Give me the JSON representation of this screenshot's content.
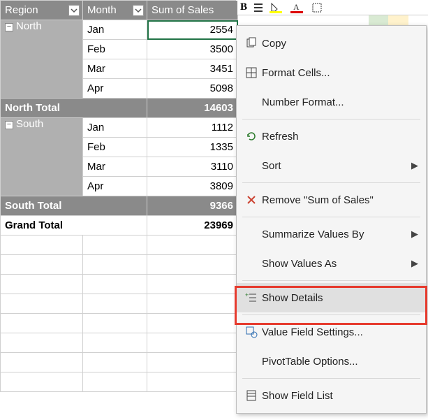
{
  "headers": {
    "region": "Region",
    "month": "Month",
    "sum": "Sum of Sales"
  },
  "regions": [
    {
      "name": "North",
      "rows": [
        {
          "month": "Jan",
          "value": 2554
        },
        {
          "month": "Feb",
          "value": 3500
        },
        {
          "month": "Mar",
          "value": 3451
        },
        {
          "month": "Apr",
          "value": 5098
        }
      ],
      "total_label": "North Total",
      "total_value": 14603
    },
    {
      "name": "South",
      "rows": [
        {
          "month": "Jan",
          "value": 1112
        },
        {
          "month": "Feb",
          "value": 1335
        },
        {
          "month": "Mar",
          "value": 3110
        },
        {
          "month": "Apr",
          "value": 3809
        }
      ],
      "total_label": "South Total",
      "total_value": 9366
    }
  ],
  "grand": {
    "label": "Grand Total",
    "value": 23969
  },
  "ctx": {
    "copy": "Copy",
    "format_cells": "Format Cells...",
    "number_format": "Number Format...",
    "refresh": "Refresh",
    "sort": "Sort",
    "remove": "Remove \"Sum of Sales\"",
    "summarize": "Summarize Values By",
    "show_values": "Show Values As",
    "show_details": "Show Details",
    "vfs": "Value Field Settings...",
    "pt_options": "PivotTable Options...",
    "field_list": "Show Field List"
  },
  "toolbar": {
    "bold": "B"
  },
  "chart_data": {
    "type": "table",
    "title": "PivotTable: Sum of Sales by Region and Month",
    "columns": [
      "Region",
      "Month",
      "Sum of Sales"
    ],
    "rows": [
      [
        "North",
        "Jan",
        2554
      ],
      [
        "North",
        "Feb",
        3500
      ],
      [
        "North",
        "Mar",
        3451
      ],
      [
        "North",
        "Apr",
        5098
      ],
      [
        "South",
        "Jan",
        1112
      ],
      [
        "South",
        "Feb",
        1335
      ],
      [
        "South",
        "Mar",
        3110
      ],
      [
        "South",
        "Apr",
        3809
      ]
    ],
    "subtotals": [
      {
        "label": "North Total",
        "value": 14603
      },
      {
        "label": "South Total",
        "value": 9366
      }
    ],
    "grand_total": 23969
  }
}
